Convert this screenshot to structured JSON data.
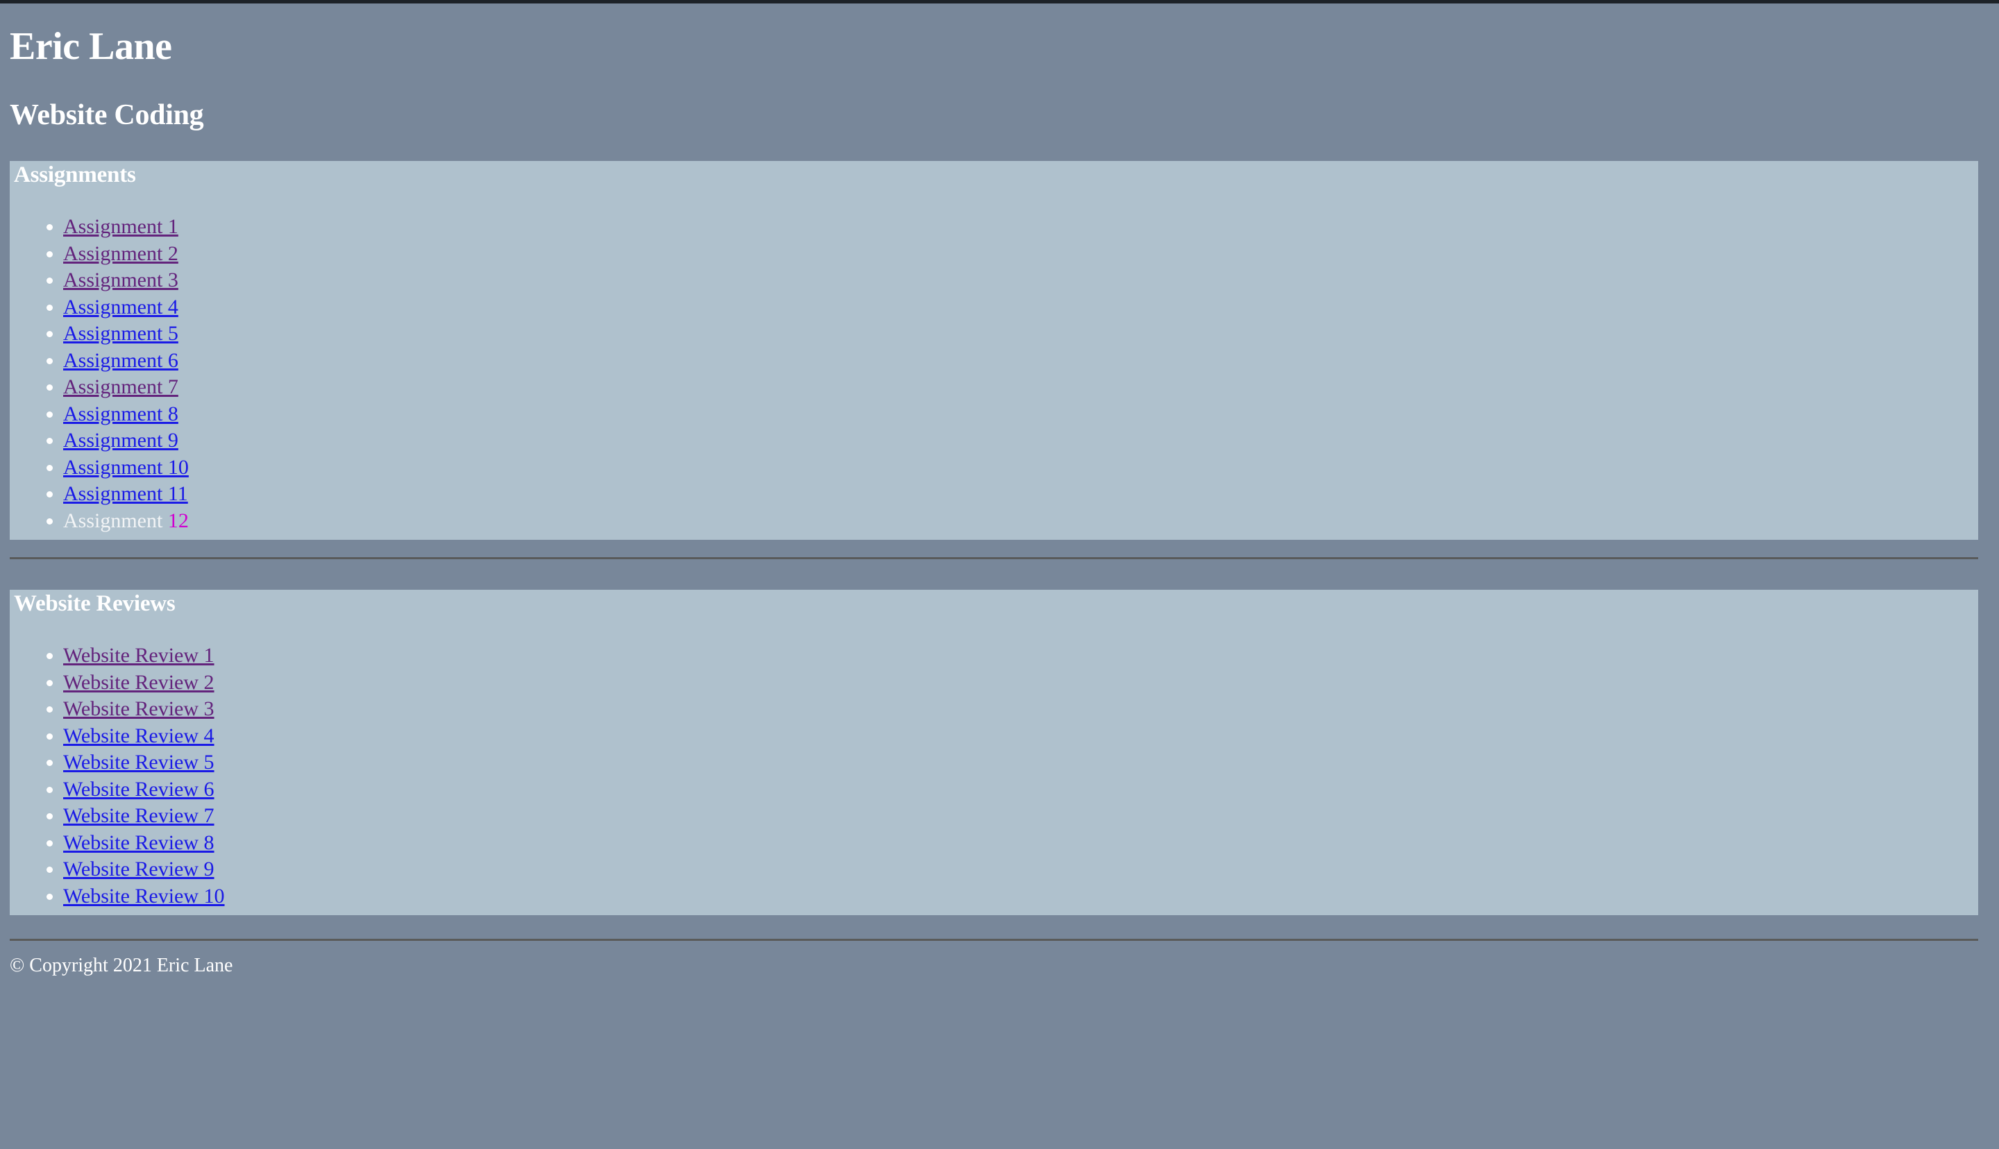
{
  "page": {
    "title": "Eric Lane",
    "subtitle": "Website Coding"
  },
  "colors": {
    "body_background": "#78879a",
    "section_background": "#afc1cd",
    "heading_text": "#ffffff",
    "link_unvisited": "#1a1ae6",
    "link_visited": "#63237c",
    "accent_magenta": "#d000d0",
    "rule": "#595a5b",
    "top_edge": "#1d2228"
  },
  "assignments": {
    "heading": "Assignments",
    "items": [
      {
        "label": "Assignment 1",
        "state": "visited",
        "is_link": true
      },
      {
        "label": "Assignment 2",
        "state": "visited",
        "is_link": true
      },
      {
        "label": "Assignment 3",
        "state": "visited",
        "is_link": true
      },
      {
        "label": "Assignment 4",
        "state": "unvisited",
        "is_link": true
      },
      {
        "label": "Assignment 5",
        "state": "unvisited",
        "is_link": true
      },
      {
        "label": "Assignment 6",
        "state": "unvisited",
        "is_link": true
      },
      {
        "label": "Assignment 7",
        "state": "visited",
        "is_link": true
      },
      {
        "label": "Assignment 8",
        "state": "unvisited",
        "is_link": true
      },
      {
        "label": "Assignment 9",
        "state": "unvisited",
        "is_link": true
      },
      {
        "label": "Assignment 10",
        "state": "unvisited",
        "is_link": true
      },
      {
        "label": "Assignment 11",
        "state": "unvisited",
        "is_link": true
      }
    ],
    "last_item": {
      "text": "Assignment ",
      "number": "12",
      "is_link": false
    }
  },
  "website_reviews": {
    "heading": "Website Reviews",
    "items": [
      {
        "label": "Website Review 1",
        "state": "visited",
        "is_link": true
      },
      {
        "label": "Website Review 2",
        "state": "visited",
        "is_link": true
      },
      {
        "label": "Website Review 3",
        "state": "visited",
        "is_link": true
      },
      {
        "label": "Website Review 4",
        "state": "unvisited",
        "is_link": true
      },
      {
        "label": "Website Review 5",
        "state": "unvisited",
        "is_link": true
      },
      {
        "label": "Website Review 6",
        "state": "unvisited",
        "is_link": true
      },
      {
        "label": "Website Review 7",
        "state": "unvisited",
        "is_link": true
      },
      {
        "label": "Website Review 8",
        "state": "unvisited",
        "is_link": true
      },
      {
        "label": "Website Review 9",
        "state": "unvisited",
        "is_link": true
      },
      {
        "label": "Website Review 10",
        "state": "unvisited",
        "is_link": true
      }
    ]
  },
  "footer": {
    "copyright": "© Copyright 2021 Eric Lane"
  }
}
